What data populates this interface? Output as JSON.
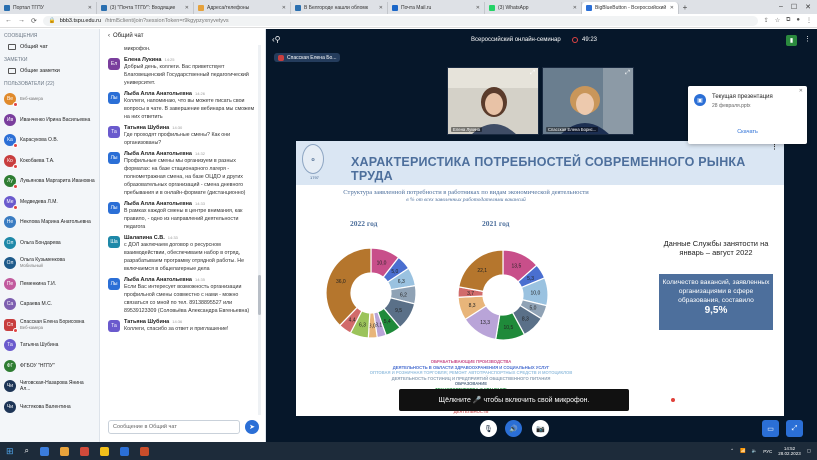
{
  "browser": {
    "tabs": [
      {
        "label": "Портал ТГПУ",
        "color": "#2a6fb0",
        "active": false
      },
      {
        "label": "(3) \"Почта ТГПУ\": Входящие",
        "color": "#2a6fb0",
        "active": false
      },
      {
        "label": "Адреса/телефоны",
        "color": "#e6a23c",
        "active": false
      },
      {
        "label": "В Белгороде нашли обломк",
        "color": "#2a6fb0",
        "active": false
      },
      {
        "label": "Почта Mail.ru",
        "color": "#1a66c8",
        "active": false
      },
      {
        "label": "(3) WhatsApp",
        "color": "#25d366",
        "active": false
      },
      {
        "label": "BigBlueButton - Всероссийский",
        "color": "#2b6fd6",
        "active": true
      }
    ],
    "url_host": "bbb3.tspu.edu.ru",
    "url_path": "/html5client/join?sessionToken=r9kgypzyxnyvetyvs",
    "new_tab": "+",
    "win_controls": [
      "–",
      "☐",
      "✕"
    ]
  },
  "sidebar": {
    "messages_title": "СООБЩЕНИЯ",
    "public_chat": "Общий чат",
    "notes_title": "ЗАМЕТКИ",
    "shared_notes": "Общие заметки",
    "users_title": "ПОЛЬЗОВАТЕЛИ (22)",
    "users": [
      {
        "initials": "Ве",
        "name": "",
        "sub": "Веб-камера",
        "color": "#e08a2b",
        "mic": true,
        "round": true
      },
      {
        "initials": "Ив",
        "name": "Иванченко Ирина Васильевна",
        "sub": "",
        "color": "#7a3e9d",
        "mic": false,
        "round": true
      },
      {
        "initials": "Ка",
        "name": "Карасукова О.В.",
        "sub": "",
        "color": "#2b6fd6",
        "mic": true,
        "round": true
      },
      {
        "initials": "Ко",
        "name": "Кокобаева Т.А.",
        "sub": "",
        "color": "#c83e3e",
        "mic": true,
        "round": true
      },
      {
        "initials": "Лу",
        "name": "Лукьянова Маргарита Ивановна",
        "sub": "",
        "color": "#2e7d32",
        "mic": true,
        "round": true
      },
      {
        "initials": "Ме",
        "name": "Медведева Л.М.",
        "sub": "",
        "color": "#6a5acd",
        "mic": true,
        "round": true
      },
      {
        "initials": "Не",
        "name": "Неклова Марина Анатольевна",
        "sub": "",
        "color": "#3a7cc2",
        "mic": false,
        "round": true
      },
      {
        "initials": "Ол",
        "name": "Ольга Бондарева",
        "sub": "",
        "color": "#1e88a8",
        "mic": false,
        "round": true
      },
      {
        "initials": "Ол",
        "name": "Ольга Кузьменкова",
        "sub": "Мобильный",
        "color": "#1e5a8a",
        "mic": false,
        "round": true
      },
      {
        "initials": "Пе",
        "name": "Пеменкина Т.И.",
        "sub": "",
        "color": "#c25b9e",
        "mic": false,
        "round": true
      },
      {
        "initials": "Са",
        "name": "Сараева М.С.",
        "sub": "",
        "color": "#7d5fb0",
        "mic": false,
        "round": true
      },
      {
        "initials": "Сп",
        "name": "Спасская Елена Борисовна",
        "sub": "Веб-камера",
        "color": "#c83e3e",
        "mic": true,
        "round": false
      },
      {
        "initials": "Та",
        "name": "Татьяна Шубина",
        "sub": "",
        "color": "#6a5acd",
        "mic": false,
        "round": true
      },
      {
        "initials": "ФГ",
        "name": "ФГБОУ \"НГПУ\"",
        "sub": "",
        "color": "#2e7d32",
        "mic": false,
        "round": true
      },
      {
        "initials": "Чи",
        "name": "Чиговская-Назарова Янина Ал...",
        "sub": "",
        "color": "#1d3557",
        "mic": false,
        "round": true
      },
      {
        "initials": "Чи",
        "name": "Чистякова Валентина",
        "sub": "",
        "color": "#1d3557",
        "mic": false,
        "round": true
      }
    ]
  },
  "chat": {
    "header": "Общий чат",
    "back": "‹",
    "messages": [
      {
        "initials": "",
        "author": "",
        "time": "",
        "text": "микрофон.",
        "color": "#fff"
      },
      {
        "initials": "Ел",
        "author": "Елена Лукина",
        "time": "14:25",
        "text": "Добрый день, коллеги. Вас приветствует Благовещенский Государственный педагогический университет.",
        "color": "#7a3e9d"
      },
      {
        "initials": "Лы",
        "author": "Лыба Алла Анатольевна",
        "time": "14:26",
        "text": "Коллеги, напоминаю, что вы можете писать свои вопросы в чате. В завершение вебинара мы сможем на них ответить",
        "color": "#2b6fd6"
      },
      {
        "initials": "Та",
        "author": "Татьяна Шубина",
        "time": "14:30",
        "text": "Где проходят профильные смены? Как они организованы?",
        "color": "#6a5acd"
      },
      {
        "initials": "Лы",
        "author": "Лыба Алла Анатольевна",
        "time": "14:32",
        "text": "Профильные смены мы организуем в разных форматах: на базе стационарного лагеря - полнометражная смена, на базе ОЦДО и других образовательных организаций - смена дневного пребывания и в онлайн-формате (дистанционно)",
        "color": "#2b6fd6"
      },
      {
        "initials": "Лы",
        "author": "Лыба Алла Анатольевна",
        "time": "14:33",
        "text": "В рамках каждой смены в центре внимания, как правило, - одно из направлений деятельности педагога",
        "color": "#2b6fd6"
      },
      {
        "initials": "Ша",
        "author": "Шалапина С.В.",
        "time": "14:33",
        "text": "с ДОЛ заключаем договор о ресурсном взаимодействии, обеспечиваем набор в отряд, разрабатываем программу отрядной работы. Не включаемся в общелагерные дела",
        "color": "#1e88a8"
      },
      {
        "initials": "Лы",
        "author": "Лыба Алла Анатольевна",
        "time": "14:35",
        "text": "Если Вас интересует возможность организации профильной смены совместно с нами - можно связаться со мной по тел. 89138895527 или 89539123309 (Соловьёва Александра Евгеньевна)",
        "color": "#2b6fd6"
      },
      {
        "initials": "Та",
        "author": "Татьяна Шубина",
        "time": "14:36",
        "text": "Коллеги, спасибо за ответ и приглашение!",
        "color": "#6a5acd"
      }
    ],
    "input_placeholder": "Сообщение в Общий чат",
    "send": "➤"
  },
  "room": {
    "title": "Всероссийский онлайн-семинар",
    "timer": "49:23",
    "presenter": "Спасская Елена Бо...",
    "webcams": [
      {
        "name": "Елена Лукина",
        "bg": "#d4d1c8",
        "hair": "#5a3b2b",
        "shirt": "#3f4d66"
      },
      {
        "name": "Спасская Елена Борис...",
        "bg": "#6a7e8f",
        "hair": "#c9965a",
        "shirt": "#1c2f52"
      }
    ]
  },
  "slide": {
    "title": "ХАРАКТЕРИСТИКА ПОТРЕБНОСТЕЙ СОВРЕМЕННОГО РЫНКА ТРУДА",
    "logo_year": "1797",
    "caption": "Структура заявленной потребности в работниках по видам экономической деятельности",
    "caption_sub": "в % от всех заявленных работодателями вакансий",
    "info_title": "Данные Службы занятости на январь – август 2022",
    "info_box": "Количество вакансий, заявленных организациями в сфере образования, составило",
    "info_value": "9,5%",
    "legend": [
      {
        "text": "ОБРАБАТЫВАЮЩИЕ ПРОИЗВОДСТВА",
        "color": "#c84f8a"
      },
      {
        "text": "ДЕЯТЕЛЬНОСТЬ В ОБЛАСТИ ЗДРАВООХРАНЕНИЯ И СОЦИАЛЬНЫХ УСЛУГ",
        "color": "#4a6fd0"
      },
      {
        "text": "ОПТОВАЯ И РОЗНИЧНАЯ ТОРГОВЛЯ; РЕМОНТ АВТОТРАНСПОРТНЫХ СРЕДСТВ И МОТОЦИКЛОВ",
        "color": "#9ac2e0"
      },
      {
        "text": "ДЕЯТЕЛЬНОСТЬ ГОСТИНИЦ И ПРЕДПРИЯТИЙ ОБЩЕСТВЕННОГО ПИТАНИЯ",
        "color": "#8fa2b5"
      },
      {
        "text": "ОБРАЗОВАНИЕ",
        "color": "#5a7088"
      },
      {
        "text": "ТРАНСПОРТИРОВКА И ХРАНЕНИЕ",
        "color": "#1f8a3a"
      },
      {
        "text": "СТРОИТЕЛЬСТВО",
        "color": "#b9a4d8"
      },
      {
        "text": "ДЕЯТЕЛЬНОСТЬ ПРОФЕССИОНАЛЬНАЯ НАУЧНАЯ И ТЕХНИЧЕСКАЯ",
        "color": "#e8b57a"
      },
      {
        "text": "ДЕЯТЕЛЬНОСТЬ",
        "color": "#9bc35a"
      },
      {
        "text": "ДЕЯТЕЛЬНОСТЬ",
        "color": "#d16b6b"
      }
    ]
  },
  "chart_data": [
    {
      "type": "pie",
      "title": "2022 год",
      "labels": [
        "",
        "",
        "",
        "",
        "",
        "",
        "",
        "",
        "",
        "",
        ""
      ],
      "values": [
        10.0,
        5.0,
        6.3,
        6.2,
        9.5,
        5.4,
        3.1,
        3.0,
        6.3,
        4.4,
        36.0
      ],
      "colors": [
        "#c84f8a",
        "#4a6fd0",
        "#9ac2e0",
        "#8fa2b5",
        "#5a7088",
        "#1f8a3a",
        "#b9a4d8",
        "#e8b57a",
        "#9bc35a",
        "#d16b6b",
        "#b5762d"
      ],
      "data_labels": [
        "10,0",
        "5,0",
        "6,3",
        "6,2",
        "9,5",
        "5,4",
        "3,1",
        "3,0",
        "6,3",
        "4,4",
        "36,0"
      ]
    },
    {
      "type": "pie",
      "title": "2021 год",
      "labels": [
        "",
        "",
        "",
        "",
        "",
        "",
        "",
        "",
        "",
        ""
      ],
      "values": [
        13.5,
        5.3,
        10.0,
        5.0,
        8.3,
        10.5,
        13.3,
        8.3,
        3.7,
        22.1
      ],
      "colors": [
        "#c84f8a",
        "#4a6fd0",
        "#9ac2e0",
        "#8fa2b5",
        "#5a7088",
        "#1f8a3a",
        "#b9a4d8",
        "#e8b57a",
        "#d16b6b",
        "#b5762d"
      ],
      "data_labels": [
        "13,5",
        "5,3",
        "10,0",
        "5,0",
        "8,3",
        "10,5",
        "13,3",
        "8,3",
        "3,7",
        "22,1"
      ]
    }
  ],
  "toast": "Щёлкните 🎤 чтобы включить свой микрофон.",
  "notification": {
    "title": "Текущая презентация",
    "file": "28 февраля.pptx",
    "link": "Скачать",
    "close": "✕"
  },
  "taskbar": {
    "time": "14:52",
    "date": "28.02.2023",
    "lang": "РУС"
  }
}
